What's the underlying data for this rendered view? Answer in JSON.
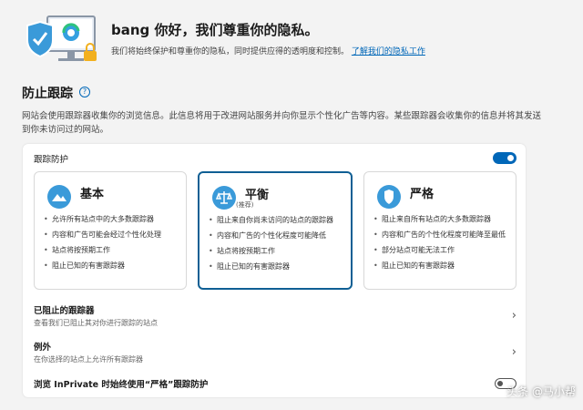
{
  "hero": {
    "title": "bang 你好，我们尊重你的隐私。",
    "description": "我们将始终保护和尊重你的隐私，同时提供应得的透明度和控制。",
    "link": "了解我们的隐私工作"
  },
  "section": {
    "title": "防止跟踪",
    "description": "网站会使用跟踪器收集你的浏览信息。此信息将用于改进网站服务并向你显示个性化广告等内容。某些跟踪器会收集你的信息并将其发送到你未访问过的网站。"
  },
  "panel": {
    "header": "跟踪防护",
    "toggle_state": "on",
    "cards": [
      {
        "title": "基本",
        "subtitle": "",
        "icon": "mountain-icon",
        "selected": false,
        "items": [
          "允许所有站点中的大多数跟踪器",
          "内容和广告可能会经过个性化处理",
          "站点将按预期工作",
          "阻止已知的有害跟踪器"
        ]
      },
      {
        "title": "平衡",
        "subtitle": "(推荐)",
        "icon": "scale-icon",
        "selected": true,
        "items": [
          "阻止来自你尚未访问的站点的跟踪器",
          "内容和广告的个性化程度可能降低",
          "站点将按预期工作",
          "阻止已知的有害跟踪器"
        ]
      },
      {
        "title": "严格",
        "subtitle": "",
        "icon": "shield-icon",
        "selected": false,
        "items": [
          "阻止来自所有站点的大多数跟踪器",
          "内容和广告的个性化程度可能降至最低",
          "部分站点可能无法工作",
          "阻止已知的有害跟踪器"
        ]
      }
    ],
    "rows": [
      {
        "title": "已阻止的跟踪器",
        "description": "查看我们已阻止其对你进行跟踪的站点"
      },
      {
        "title": "例外",
        "description": "在你选择的站点上允许所有跟踪器"
      },
      {
        "title": "浏览 InPrivate 时始终使用“严格”跟踪防护",
        "description": ""
      }
    ]
  },
  "watermark": "头条 @马小帮",
  "colors": {
    "accent": "#0067b8",
    "selected_border": "#0f5f94",
    "background": "#f3f3f3"
  }
}
